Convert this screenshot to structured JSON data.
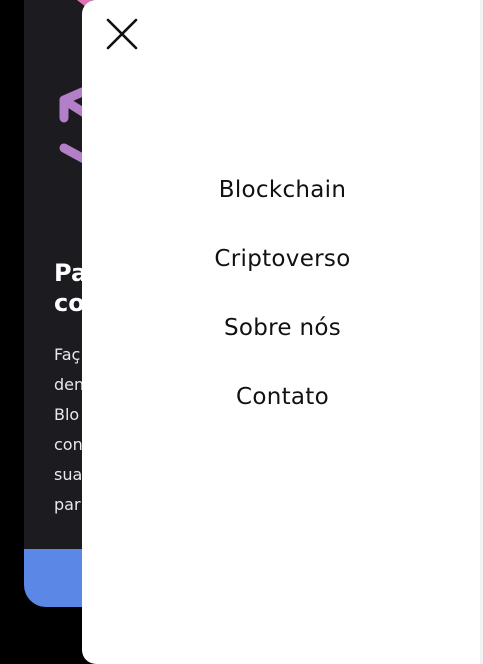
{
  "background": {
    "heading_line1": "Pa",
    "heading_line2": "co",
    "paragraph_lines": [
      "Faç",
      "den",
      "Blo",
      "con",
      "sua",
      "par"
    ]
  },
  "drawer": {
    "close_icon": "close-icon",
    "menu_items": [
      {
        "label": "Blockchain"
      },
      {
        "label": "Criptoverso"
      },
      {
        "label": "Sobre nós"
      },
      {
        "label": "Contato"
      }
    ]
  },
  "colors": {
    "page_background": "#000000",
    "card_background": "#1c1b1f",
    "cta_blue": "#5b87e6",
    "drawer_background": "#ffffff",
    "menu_text": "#111111",
    "logo_purple": "#b37fc9",
    "logo_pink": "#e36fb6"
  }
}
